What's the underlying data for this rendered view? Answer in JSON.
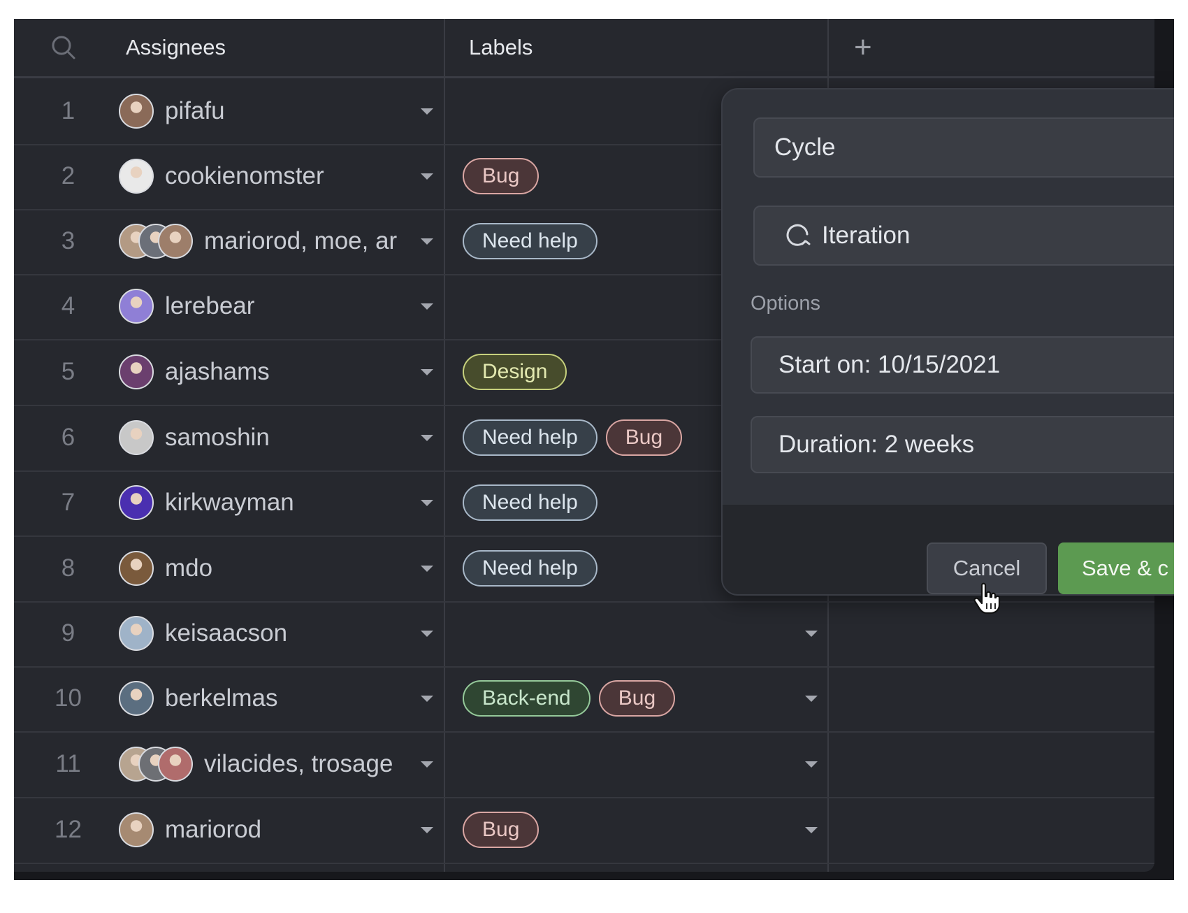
{
  "header": {
    "search_icon": "search-icon",
    "col_assignees": "Assignees",
    "col_labels": "Labels",
    "add_column_icon": "plus-icon",
    "add_column_glyph": "+"
  },
  "rows": [
    {
      "num": "1",
      "assignee": "pifafu",
      "labels": []
    },
    {
      "num": "2",
      "assignee": "cookienomster",
      "labels": [
        "Bug"
      ]
    },
    {
      "num": "3",
      "assignee": "mariorod, moe, ar",
      "labels": [
        "Need help"
      ]
    },
    {
      "num": "4",
      "assignee": "lerebear",
      "labels": []
    },
    {
      "num": "5",
      "assignee": "ajashams",
      "labels": [
        "Design"
      ]
    },
    {
      "num": "6",
      "assignee": "samoshin",
      "labels": [
        "Need help",
        "Bug"
      ]
    },
    {
      "num": "7",
      "assignee": "kirkwayman",
      "labels": [
        "Need help"
      ]
    },
    {
      "num": "8",
      "assignee": "mdo",
      "labels": [
        "Need help"
      ]
    },
    {
      "num": "9",
      "assignee": "keisaacson",
      "labels": []
    },
    {
      "num": "10",
      "assignee": "berkelmas",
      "labels": [
        "Back-end",
        "Bug"
      ]
    },
    {
      "num": "11",
      "assignee": "vilacides, trosage",
      "labels": []
    },
    {
      "num": "12",
      "assignee": "mariorod",
      "labels": [
        "Bug"
      ]
    }
  ],
  "modal": {
    "field_name": "Cycle",
    "field_type": "Iteration",
    "options_label": "Options",
    "start_on": "Start on: 10/15/2021",
    "duration": "Duration: 2 weeks",
    "cancel": "Cancel",
    "save": "Save & c"
  },
  "colors": {
    "background": "#26282e",
    "bug": "#d9a6a3",
    "need_help": "#a8b8c8",
    "design": "#c6d07d",
    "back_end": "#95c99a",
    "save_button": "#5c9a51"
  }
}
